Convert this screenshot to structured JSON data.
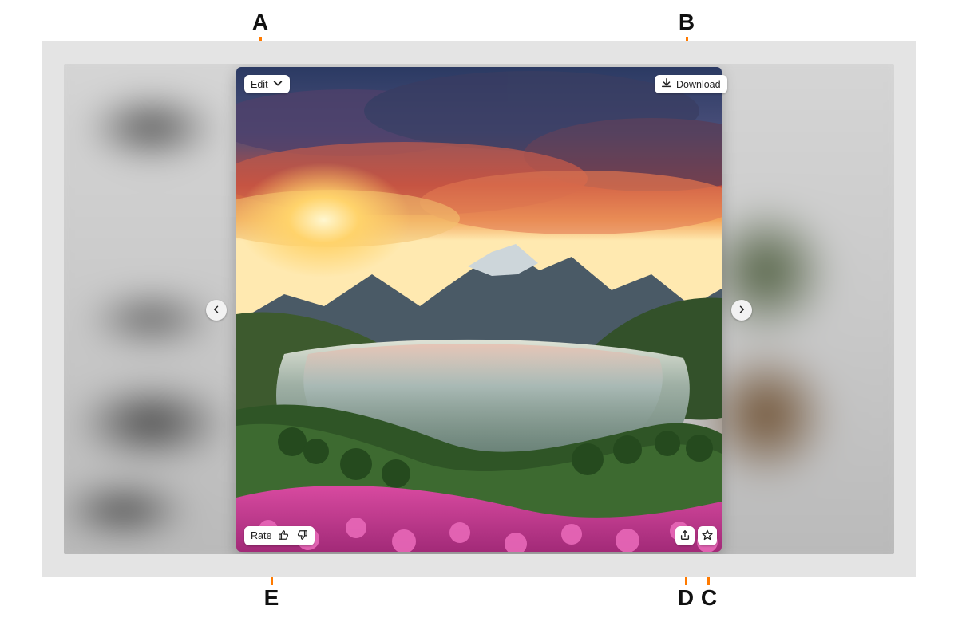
{
  "annotations": {
    "A": "A",
    "B": "B",
    "C": "C",
    "D": "D",
    "E": "E"
  },
  "viewer": {
    "edit_label": "Edit",
    "download_label": "Download",
    "rate_label": "Rate",
    "icons": {
      "edit_chevron": "chevron-down-icon",
      "download": "download-icon",
      "thumbs_up": "thumbs-up-icon",
      "thumbs_down": "thumbs-down-icon",
      "share": "share-icon",
      "favorite": "star-icon",
      "prev": "chevron-left-icon",
      "next": "chevron-right-icon"
    }
  },
  "colors": {
    "callout": "#ff7a00",
    "chip_bg": "#ffffff"
  }
}
